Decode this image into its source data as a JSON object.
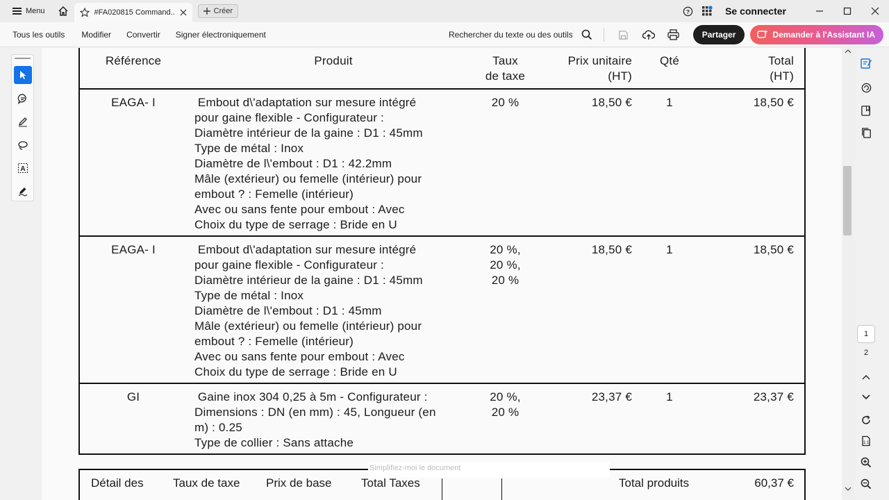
{
  "titlebar": {
    "menu_label": "Menu",
    "tab_title": "#FA020815 Command...",
    "create_label": "Créer",
    "login_label": "Se connecter"
  },
  "toolbar": {
    "items": [
      "Tous les outils",
      "Modifier",
      "Convertir",
      "Signer électroniquement"
    ],
    "search_label": "Rechercher du texte ou des outils",
    "share_label": "Partager",
    "ai_label": "Demander à l'Assistant IA"
  },
  "table": {
    "headers": {
      "ref": "Référence",
      "prod": "Produit",
      "tax": [
        "Taux",
        "de taxe"
      ],
      "pu": [
        "Prix unitaire",
        "(HT)"
      ],
      "qty": "Qté",
      "tot": [
        "Total",
        "(HT)"
      ]
    },
    "rows": [
      {
        "ref": "EAGA- I",
        "lines": [
          " Embout d\\'adaptation sur mesure intégré",
          "pour gaine flexible - Configurateur :",
          "Diamètre intérieur de la gaine : D1 : 45mm",
          "Type de métal : Inox",
          "Diamètre de l\\'embout : D1 : 42.2mm",
          "Mâle (extérieur) ou femelle (intérieur) pour",
          "embout ? : Femelle (intérieur)",
          "Avec ou sans fente pour embout : Avec",
          "Choix du type de serrage : Bride en U"
        ],
        "tax": [
          "20 %"
        ],
        "pu": "18,50 €",
        "qty": "1",
        "tot": "18,50 €"
      },
      {
        "ref": "EAGA- I",
        "lines": [
          " Embout d\\'adaptation sur mesure intégré",
          "pour gaine flexible - Configurateur :",
          "Diamètre intérieur de la gaine : D1 : 45mm",
          "Type de métal : Inox",
          "Diamètre de l\\'embout : D1 : 45mm",
          "Mâle (extérieur) ou femelle (intérieur) pour",
          "embout ? : Femelle (intérieur)",
          "Avec ou sans fente pour embout : Avec",
          "Choix du type de serrage : Bride en U"
        ],
        "tax": [
          "20 %,",
          "20 %,",
          "20 %"
        ],
        "pu": "18,50 €",
        "qty": "1",
        "tot": "18,50 €"
      },
      {
        "ref": "GI",
        "lines": [
          " Gaine inox 304 0,25 à 5m - Configurateur :",
          "Dimensions : DN (en mm) : 45, Longueur (en",
          "m) : 0.25",
          "Type de collier : Sans attache"
        ],
        "tax": [
          "20 %,",
          "20 %"
        ],
        "pu": "23,37 €",
        "qty": "1",
        "tot": "23,37 €"
      }
    ]
  },
  "summary": {
    "col1": "Détail des",
    "col2": "Taux de taxe",
    "col3": "Prix de base",
    "col4": "Total Taxes",
    "total_label": "Total produits",
    "total_value": "60,37 €"
  },
  "tip_text": "Simplifiez-moi le document",
  "pages": {
    "current": "1",
    "next": "2"
  }
}
